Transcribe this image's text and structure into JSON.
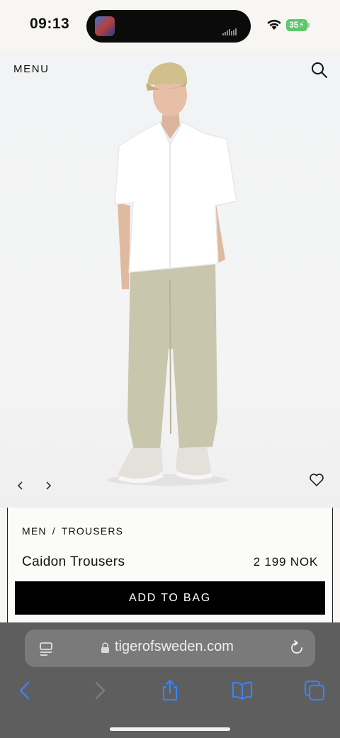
{
  "status_bar": {
    "time": "09:13",
    "battery": "35"
  },
  "site_header": {
    "menu_label": "MENU",
    "search_icon": "search-icon"
  },
  "gallery": {
    "prev_icon": "chevron-left-icon",
    "next_icon": "chevron-right-icon",
    "wishlist_icon": "heart-icon"
  },
  "product": {
    "breadcrumb": [
      "MEN",
      "TROUSERS"
    ],
    "breadcrumb_separator": "/",
    "name": "Caidon Trousers",
    "price": "2 199 NOK",
    "add_to_bag_label": "ADD TO BAG"
  },
  "browser": {
    "url": "tigerofsweden.com",
    "toolbar": [
      "back-icon",
      "forward-icon",
      "share-icon",
      "bookmarks-icon",
      "tabs-icon"
    ]
  },
  "colors": {
    "accent": "#000000",
    "toolbar_blue": "#3b82f6",
    "battery_green": "#5ec76a"
  }
}
